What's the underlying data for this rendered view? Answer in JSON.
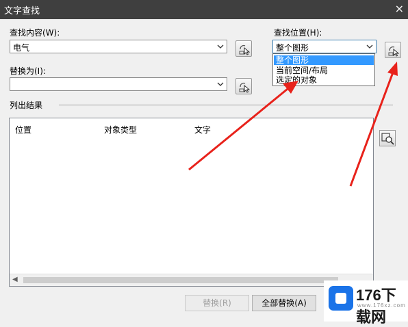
{
  "window": {
    "title": "文字查找",
    "close": "×"
  },
  "find": {
    "label": "查找内容(W):",
    "value": "电气"
  },
  "replace": {
    "label": "替换为(I):",
    "value": ""
  },
  "location": {
    "label": "查找位置(H):",
    "selected": "整个图形",
    "options": [
      "整个图形",
      "当前空间/布局",
      "选定的对象"
    ]
  },
  "results": {
    "section_label": "列出结果",
    "columns": [
      "位置",
      "对象类型",
      "文字"
    ]
  },
  "buttons": {
    "replace": "替换(R)",
    "replace_all": "全部替换(A)"
  },
  "watermark": {
    "text": "176下载网",
    "sub": "www.176xz.com"
  }
}
